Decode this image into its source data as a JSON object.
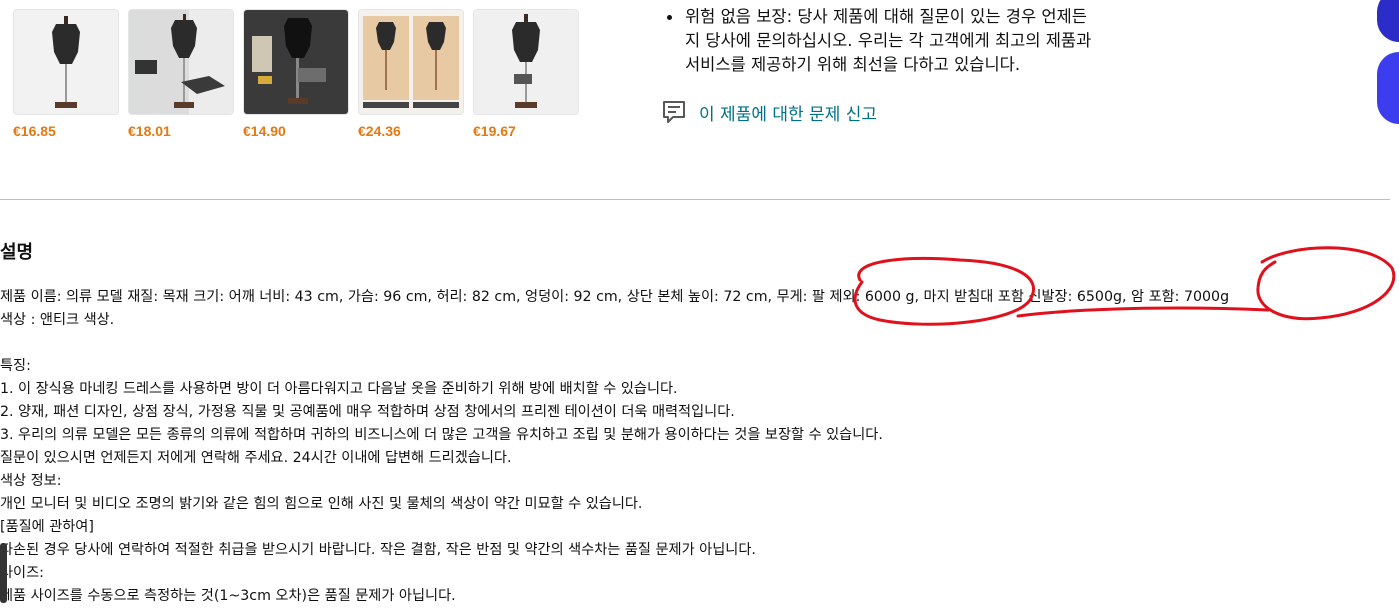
{
  "carousel": {
    "items": [
      {
        "price": "€16.85"
      },
      {
        "price": "€18.01"
      },
      {
        "price": "€14.90"
      },
      {
        "price": "€24.36"
      },
      {
        "price": "€19.67"
      }
    ]
  },
  "guarantee": {
    "lines": [
      "위험 없음 보장: 당사 제품에 대해 질문이 있는 경우 언제든",
      "지 당사에 문의하십시오. 우리는 각 고객에게 최고의 제품과",
      "서비스를 제공하기 위해 최선을 다하고 있습니다."
    ]
  },
  "report": {
    "label": "이 제품에 대한 문제 신고",
    "icon": "report-icon"
  },
  "description": {
    "title": "설명",
    "lines": [
      "제품 이름: 의류 모델 재질: 목재 크기: 어깨 너비: 43 cm, 가슴: 96 cm, 허리: 82 cm, 엉덩이: 92 cm, 상단 본체 높이: 72 cm, 무게: 팔 제외: 6000 g, 마지 받침대 포함 신발장: 6500g, 암 포함: 7000g",
      "색상 : 앤티크 색상.",
      "",
      "특징:",
      "1. 이 장식용 마네킹 드레스를 사용하면 방이 더 아름다워지고 다음날 옷을 준비하기 위해 방에 배치할 수 있습니다.",
      "2. 양재, 패션 디자인, 상점 장식, 가정용 직물 및 공예품에 매우 적합하며 상점 창에서의 프리젠 테이션이 더욱 매력적입니다.",
      "3. 우리의 의류 모델은 모든 종류의 의류에 적합하며 귀하의 비즈니스에 더 많은 고객을 유치하고 조립 및 분해가 용이하다는 것을 보장할 수 있습니다.",
      "질문이 있으시면 언제든지 저에게 연락해 주세요. 24시간 이내에 답변해 드리겠습니다.",
      "색상 정보:",
      "개인 모니터 및 비디오 조명의 밝기와 같은 힘의 힘으로 인해 사진 및 물체의 색상이 약간 미묘할 수 있습니다.",
      "[품질에 관하여]",
      "파손된 경우 당사에 연락하여 적절한 취급을 받으시기 바랍니다. 작은 결함, 작은 반점 및 약간의 색수차는 품질 문제가 아닙니다.",
      "사이즈:",
      "제품 사이즈를 수동으로 측정하는 것(1~3cm 오차)은 품질 문제가 아닙니다."
    ]
  },
  "colors": {
    "price": "#e47911",
    "link": "#007185",
    "annotation": "#e0101c"
  }
}
